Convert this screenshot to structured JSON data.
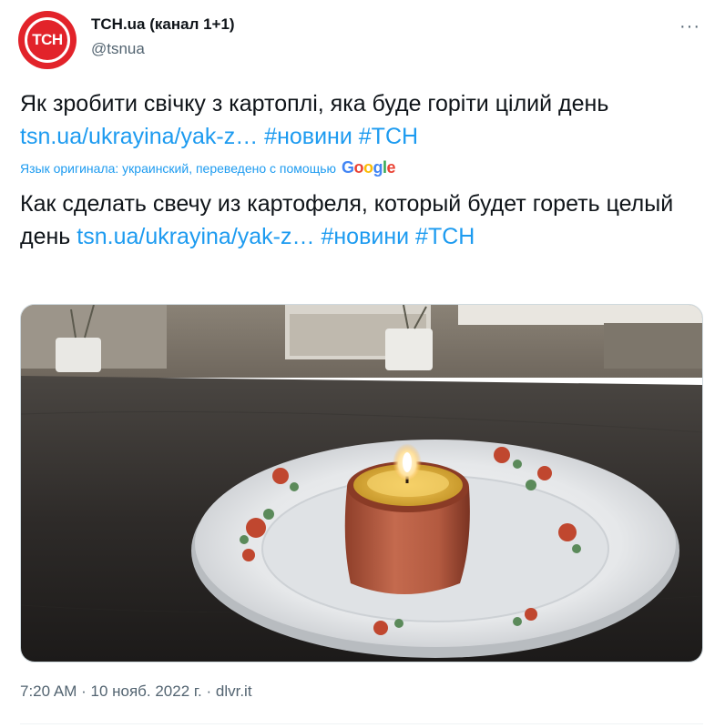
{
  "author": {
    "avatar_text": "ТСН",
    "name": "ТСН.ua (канал 1+1)",
    "handle": "@tsnua"
  },
  "menu_icon": "more-horizontal-icon",
  "more_glyph": "···",
  "tweet": {
    "text_uk_prefix": "Як зробити свічку з картоплі, яка буде горіти цілий день ",
    "text_uk_link": "tsn.ua/ukrayina/yak-z…",
    "text_uk_hashtag1": "#новини",
    "text_uk_hashtag2": "#ТСН",
    "translation_note": "Язык оригинала: украинский, переведено с помощью",
    "translator_brand": "Google",
    "text_ru_prefix": "Как сделать свечу из картофеля, который будет гореть целый день ",
    "text_ru_link": "tsn.ua/ukrayina/yak-z…",
    "text_ru_hashtag1": "#новини",
    "text_ru_hashtag2": "#ТСН"
  },
  "media": {
    "subject": "potato-candle-on-plate-photo"
  },
  "meta": {
    "time": "7:20 AM",
    "sep1": " · ",
    "date": "10 нояб. 2022 г.",
    "sep2": " · ",
    "source": "dlvr.it"
  },
  "colors": {
    "link": "#1d9bf0",
    "secondary_text": "#536471",
    "brand_red": "#e2232a"
  }
}
